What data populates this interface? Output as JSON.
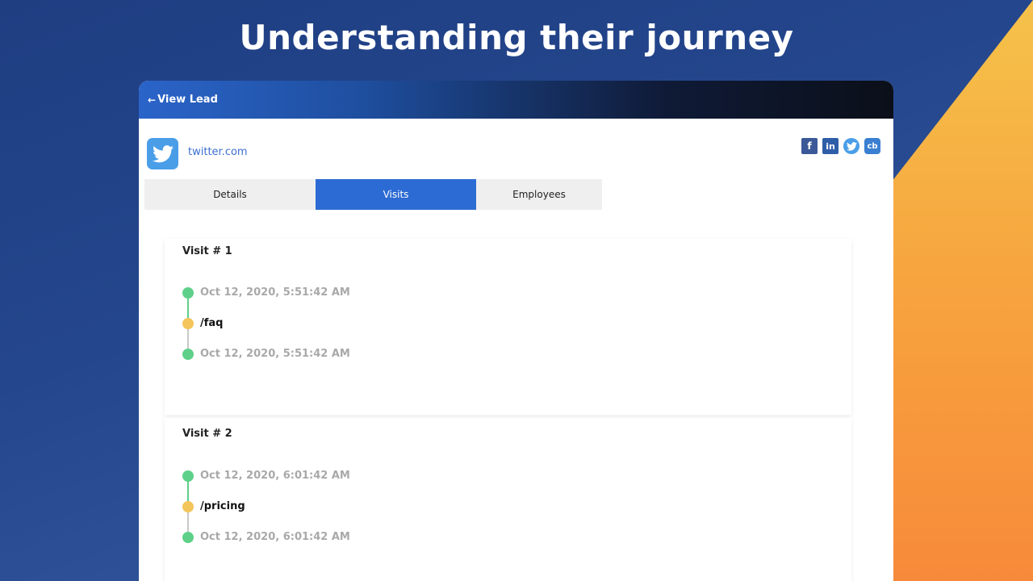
{
  "slide": {
    "title": "Understanding their journey"
  },
  "header": {
    "back_label": "View Lead",
    "back_icon": "←"
  },
  "company": {
    "domain": "twitter.com",
    "logo": "twitter-bird"
  },
  "social": {
    "facebook": "f",
    "linkedin": "in",
    "twitter": "twitter-bird",
    "crunchbase": "cb"
  },
  "tabs": [
    {
      "label": "Details",
      "active": false
    },
    {
      "label": "Visits",
      "active": true
    },
    {
      "label": "Employees",
      "active": false
    }
  ],
  "visits": [
    {
      "title": "Visit # 1",
      "start_time": "Oct 12, 2020, 5:51:42 AM",
      "page": "/faq",
      "end_time": "Oct 12, 2020, 5:51:42 AM"
    },
    {
      "title": "Visit # 2",
      "start_time": "Oct 12, 2020, 6:01:42 AM",
      "page": "/pricing",
      "end_time": "Oct 12, 2020, 6:01:42 AM"
    }
  ],
  "colors": {
    "accent": "#2c6bd3",
    "start_dot": "#5fd08a",
    "page_dot": "#f3c55a"
  }
}
